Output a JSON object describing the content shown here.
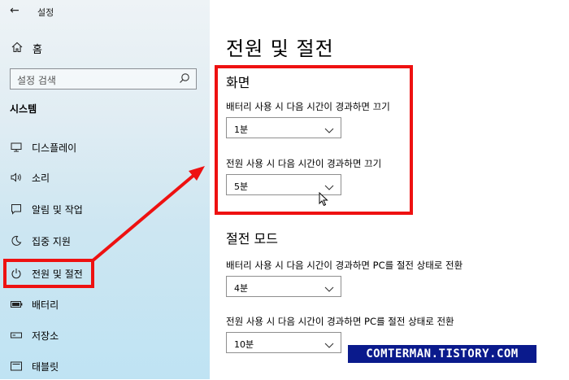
{
  "window": {
    "app_title": "설정"
  },
  "sidebar": {
    "home_label": "홈",
    "search_placeholder": "설정 검색",
    "section_label": "시스템",
    "items": [
      {
        "label": "디스플레이",
        "icon": "display-icon"
      },
      {
        "label": "소리",
        "icon": "speaker-icon"
      },
      {
        "label": "알림 및 작업",
        "icon": "notification-icon"
      },
      {
        "label": "집중 지원",
        "icon": "moon-icon"
      },
      {
        "label": "전원 및 절전",
        "icon": "power-icon",
        "selected": true
      },
      {
        "label": "배터리",
        "icon": "battery-icon"
      },
      {
        "label": "저장소",
        "icon": "storage-icon"
      },
      {
        "label": "태블릿",
        "icon": "tablet-icon"
      }
    ]
  },
  "main": {
    "page_title": "전원 및 절전",
    "screen": {
      "title": "화면",
      "battery_label": "배터리 사용 시 다음 시간이 경과하면 끄기",
      "battery_value": "1분",
      "power_label": "전원 사용 시 다음 시간이 경과하면 끄기",
      "power_value": "5분"
    },
    "sleep": {
      "title": "절전 모드",
      "battery_label": "배터리 사용 시 다음 시간이 경과하면 PC를 절전 상태로 전환",
      "battery_value": "4분",
      "power_label": "전원 사용 시 다음 시간이 경과하면 PC를 절전 상태로 전환",
      "power_value": "10분"
    }
  },
  "watermark": "COMTERMAN.TISTORY.COM",
  "colors": {
    "highlight": "#ee1111",
    "accent": "#0a62c4",
    "watermark_bg": "#0a1a8c"
  }
}
